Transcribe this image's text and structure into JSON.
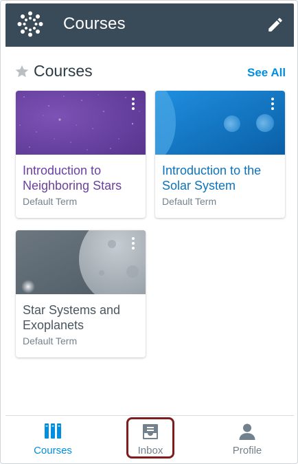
{
  "app_bar": {
    "title": "Courses",
    "background": "#394b58",
    "logo_icon": "canvas-logo-icon",
    "edit_icon": "pencil-icon"
  },
  "section": {
    "title": "Courses",
    "star_icon": "star-icon",
    "see_all_label": "See All",
    "accent": "#008ee2"
  },
  "courses": [
    {
      "title": "Introduction to Neighboring Stars",
      "term": "Default Term",
      "color": "#6b3fa0",
      "image": "purple-starfield"
    },
    {
      "title": "Introduction to the Solar System",
      "term": "Default Term",
      "color": "#0b73bd",
      "image": "blue-planets"
    },
    {
      "title": "Star Systems and Exoplanets",
      "term": "Default Term",
      "color": "#4a565f",
      "image": "gray-moon"
    }
  ],
  "tabs": [
    {
      "label": "Courses",
      "icon": "courses-icon",
      "active": true,
      "color": "#008ee2"
    },
    {
      "label": "Inbox",
      "icon": "inbox-icon",
      "active": false,
      "color": "#73818c"
    },
    {
      "label": "Profile",
      "icon": "profile-icon",
      "active": false,
      "color": "#73818c"
    }
  ],
  "highlight_color": "#7e1d1d"
}
